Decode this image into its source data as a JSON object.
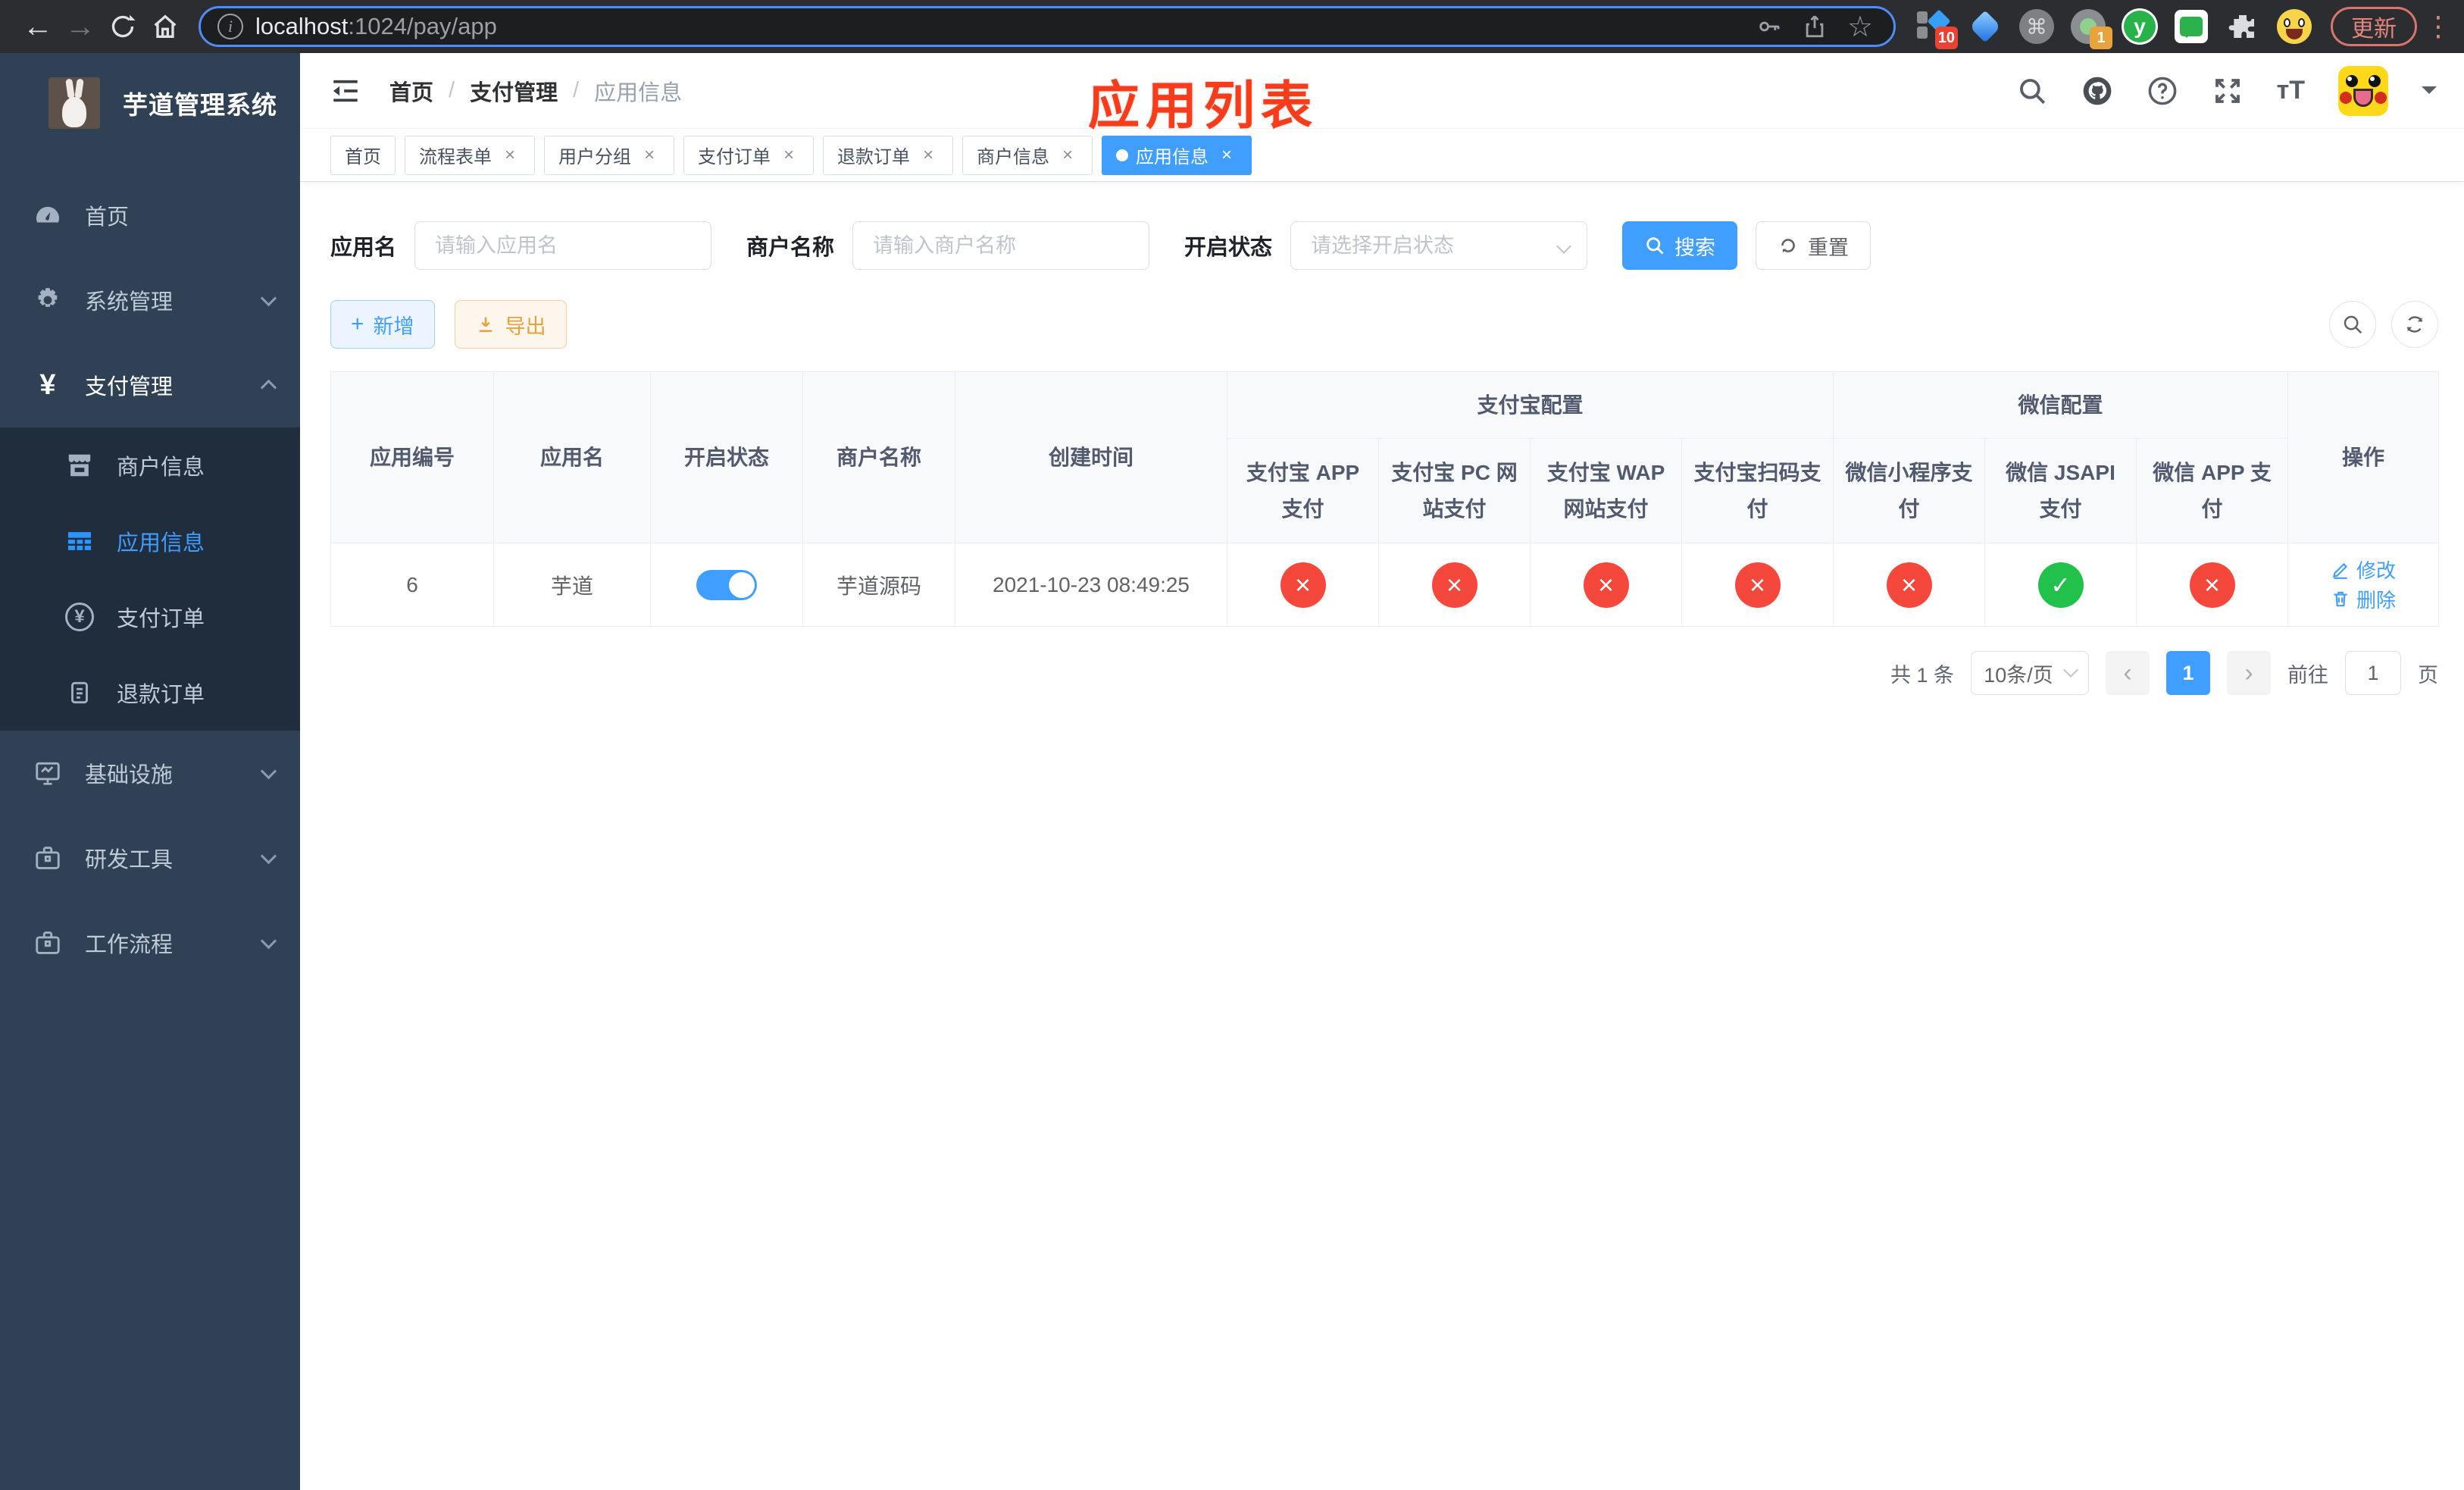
{
  "colors": {
    "accent": "#409eff",
    "danger_circle": "#f5483c",
    "success_circle": "#21c14b",
    "warning": "#e6a23c",
    "overlay_title_color": "#f63c1a",
    "sidebar_bg": "#304156",
    "submenu_bg": "#1f2d3d"
  },
  "browser": {
    "url_host": "localhost",
    "url_rest": ":1024/pay/app",
    "update_label": "更新",
    "ext_badge_ten": "10",
    "ext_badge_one": "1"
  },
  "sidebar": {
    "title": "芋道管理系统",
    "home": "首页",
    "system": "系统管理",
    "payment": "支付管理",
    "merchant_info": "商户信息",
    "app_info": "应用信息",
    "pay_order": "支付订单",
    "refund_order": "退款订单",
    "infrastructure": "基础设施",
    "dev_tools": "研发工具",
    "workflow": "工作流程"
  },
  "navbar": {
    "breadcrumb": [
      "首页",
      "支付管理",
      "应用信息"
    ],
    "breadcrumb_separator": "/",
    "overlay_title": "应用列表"
  },
  "tabs": [
    {
      "label": "首页"
    },
    {
      "label": "流程表单"
    },
    {
      "label": "用户分组"
    },
    {
      "label": "支付订单"
    },
    {
      "label": "退款订单"
    },
    {
      "label": "商户信息"
    },
    {
      "label": "应用信息"
    }
  ],
  "filters": {
    "app_name_label": "应用名",
    "app_name_placeholder": "请输入应用名",
    "merchant_label": "商户名称",
    "merchant_placeholder": "请输入商户名称",
    "status_label": "开启状态",
    "status_placeholder": "请选择开启状态",
    "search_label": "搜索",
    "reset_label": "重置"
  },
  "toolbar": {
    "add_label": "新增",
    "export_label": "导出"
  },
  "table": {
    "columns": [
      "应用编号",
      "应用名",
      "开启状态",
      "商户名称",
      "创建时间"
    ],
    "groups": [
      {
        "label": "支付宝配置",
        "children": [
          "支付宝 APP 支付",
          "支付宝 PC 网站支付",
          "支付宝 WAP 网站支付",
          "支付宝扫码支付"
        ]
      },
      {
        "label": "微信配置",
        "children": [
          "微信小程序支付",
          "微信 JSAPI 支付",
          "微信 APP 支付"
        ]
      }
    ],
    "action_column": "操作",
    "row": {
      "id": "6",
      "name": "芋道",
      "switch_class": "switch on",
      "merchant": "芋道源码",
      "created": "2021-10-23 08:49:25",
      "status_classes": [
        "status-dot red",
        "status-dot red",
        "status-dot red",
        "status-dot red",
        "status-dot red",
        "status-dot green",
        "status-dot red"
      ],
      "edit_label": "修改",
      "delete_label": "删除"
    }
  },
  "pagination": {
    "total": "共 1 条",
    "page_size": "10条/页",
    "current_page": "1",
    "goto_label": "前往",
    "goto_value": "1",
    "page_unit": "页"
  }
}
